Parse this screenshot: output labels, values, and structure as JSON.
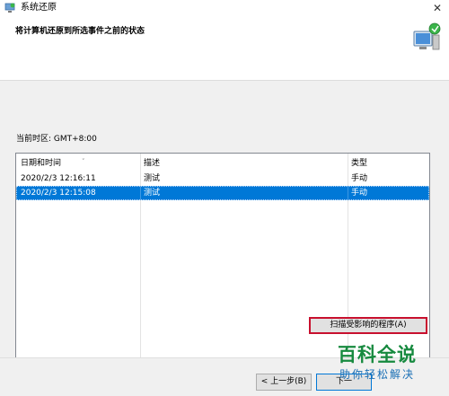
{
  "window": {
    "title": "系统还原",
    "close_glyph": "✕"
  },
  "header": {
    "heading": "将计算机还原到所选事件之前的状态"
  },
  "timezone": {
    "label": "当前时区: GMT+8:00"
  },
  "table": {
    "columns": [
      "日期和时间",
      "描述",
      "类型"
    ],
    "rows": [
      {
        "date": "2020/2/3 12:16:11",
        "description": "测试",
        "type": "手动",
        "selected": false
      },
      {
        "date": "2020/2/3 12:15:08",
        "description": "测试",
        "type": "手动",
        "selected": true
      }
    ]
  },
  "buttons": {
    "scan": "扫描受影响的程序(A)",
    "back": "< 上一步(B)",
    "next": "下一"
  },
  "watermark": {
    "title": "百科全说",
    "subtitle": "助你轻松解决"
  },
  "colors": {
    "selection": "#0078d7",
    "highlight_border": "#c8102e",
    "watermark_green": "#178a3f",
    "watermark_blue": "#1a6fb5"
  },
  "icons": {
    "app": "system-restore-icon",
    "header": "restore-computer-icon",
    "close": "close-icon",
    "sort": "sort-caret-icon"
  }
}
